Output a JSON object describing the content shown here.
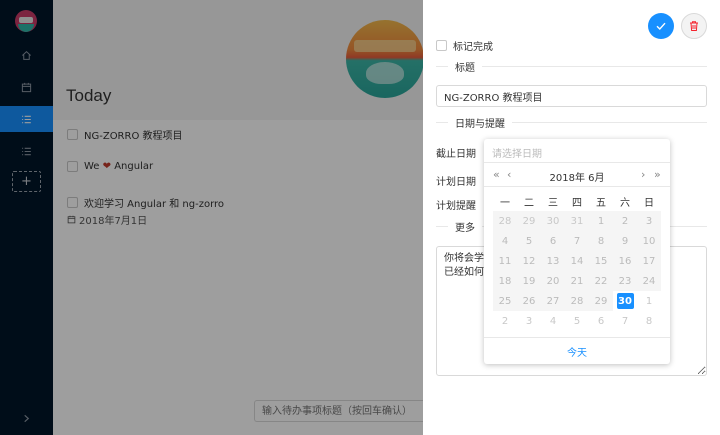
{
  "main": {
    "title": "Today",
    "todos": [
      {
        "title": "NG-ZORRO 教程项目"
      },
      {
        "title_pre": "We ",
        "heart": "❤",
        "title_post": " Angular"
      },
      {
        "title": "欢迎学习 Angular 和 ng-zorro",
        "date": "2018年7月1日"
      }
    ],
    "quick_add_placeholder": "输入待办事项标题（按回车确认）"
  },
  "drawer": {
    "mark_done_label": "标记完成",
    "section_title": "标题",
    "title_value": "NG-ZORRO 教程项目",
    "section_date": "日期与提醒",
    "due_date_label": "截止日期",
    "plan_date_label": "计划日期",
    "plan_remind_label": "计划提醒",
    "section_more": "更多",
    "notes_value": "你将会学习\n已经如何构建"
  },
  "datepicker": {
    "placeholder": "请选择日期",
    "prev_year": "«",
    "prev_month": "‹",
    "next_month": "›",
    "next_year": "»",
    "year_month": "2018年 6月",
    "weekdays": [
      "一",
      "二",
      "三",
      "四",
      "五",
      "六",
      "日"
    ],
    "weeks": [
      [
        "28",
        "29",
        "30",
        "31",
        "1",
        "2",
        "3"
      ],
      [
        "4",
        "5",
        "6",
        "7",
        "8",
        "9",
        "10"
      ],
      [
        "11",
        "12",
        "13",
        "14",
        "15",
        "16",
        "17"
      ],
      [
        "18",
        "19",
        "20",
        "21",
        "22",
        "23",
        "24"
      ],
      [
        "25",
        "26",
        "27",
        "28",
        "29",
        "30",
        "1"
      ],
      [
        "2",
        "3",
        "4",
        "5",
        "6",
        "7",
        "8"
      ]
    ],
    "selected": "30",
    "today_label": "今天"
  },
  "colors": {
    "primary": "#1890ff",
    "sider": "#001529",
    "danger": "#f5222d"
  }
}
